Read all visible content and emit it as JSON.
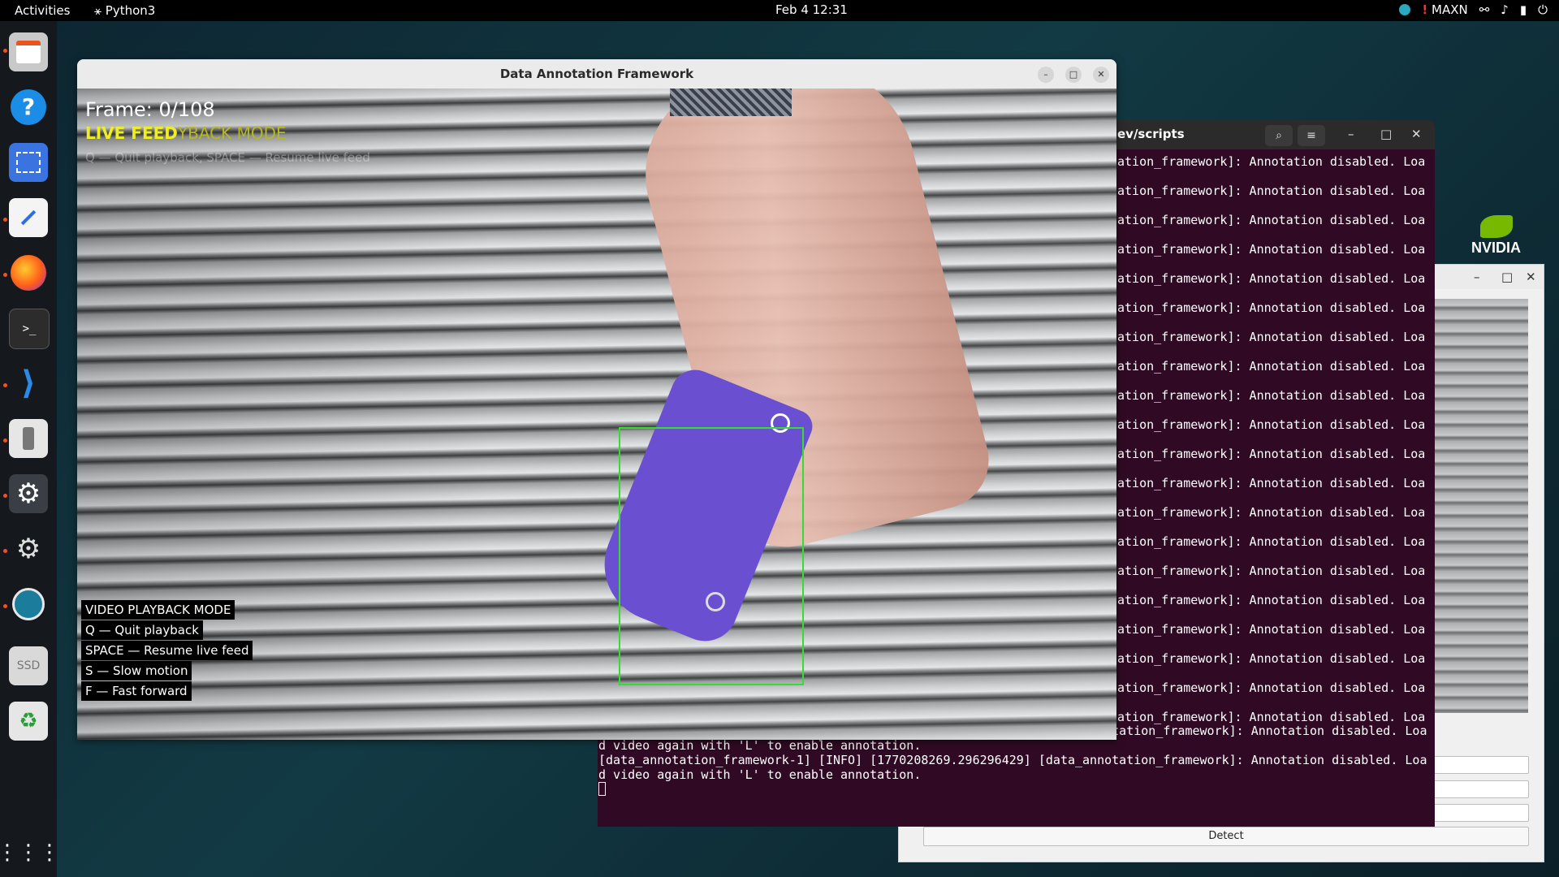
{
  "topbar": {
    "activities": "Activities",
    "app": "Python3",
    "clock": "Feb 4  12:31",
    "power_mode": "MAXN"
  },
  "dock": [
    "files-icon",
    "help-icon",
    "screenshot-icon",
    "text-editor-icon",
    "firefox-icon",
    "terminal-icon",
    "vscode-icon",
    "usb-drive-icon",
    "settings-icon",
    "settings-icon-2",
    "remote-desktop-icon",
    "ssd-icon",
    "trash-icon",
    "app-grid-icon"
  ],
  "brand": {
    "nvidia": "NVIDIA",
    "accent": "#76b900"
  },
  "main_window": {
    "title": "Data Annotation Framework"
  },
  "video": {
    "frame_label": "Frame: 0/108",
    "mode_live": "LIVE FEED",
    "mode_playback_overlap": "YBACK MODE",
    "hint_faded": "Q — Quit playback, SPACE — Resume live feed",
    "legend": [
      "VIDEO PLAYBACK MODE",
      "Q — Quit playback",
      "SPACE — Resume live feed",
      "S — Slow motion",
      "F — Fast forward"
    ],
    "bbox_color": "#33dd33",
    "object_color": "#6a4fd0"
  },
  "terminal": {
    "title": "ev/scripts",
    "repeat_line": "ation_framework]: Annotation disabled. Loa",
    "repeat_count": 20,
    "tail": [
      "d video again with 'L' to enable annotation.",
      "[data_annotation_framework-1] [INFO] [1770208269.287963414] [data_annotation_framework]: Annotation disabled. Loa",
      "d video again with 'L' to enable annotation.",
      "[data_annotation_framework-1] [INFO] [1770208269.296296429] [data_annotation_framework]: Annotation disabled. Loa",
      "d video again with 'L' to enable annotation."
    ]
  },
  "back_window": {
    "detect_label": "Detect"
  }
}
